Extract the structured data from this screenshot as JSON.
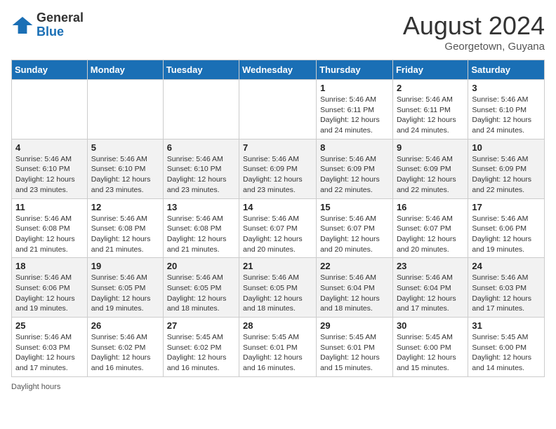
{
  "header": {
    "logo_general": "General",
    "logo_blue": "Blue",
    "month_year": "August 2024",
    "location": "Georgetown, Guyana"
  },
  "footer": {
    "daylight_label": "Daylight hours"
  },
  "days_of_week": [
    "Sunday",
    "Monday",
    "Tuesday",
    "Wednesday",
    "Thursday",
    "Friday",
    "Saturday"
  ],
  "weeks": [
    [
      {
        "day": "",
        "info": ""
      },
      {
        "day": "",
        "info": ""
      },
      {
        "day": "",
        "info": ""
      },
      {
        "day": "",
        "info": ""
      },
      {
        "day": "1",
        "info": "Sunrise: 5:46 AM\nSunset: 6:11 PM\nDaylight: 12 hours\nand 24 minutes."
      },
      {
        "day": "2",
        "info": "Sunrise: 5:46 AM\nSunset: 6:11 PM\nDaylight: 12 hours\nand 24 minutes."
      },
      {
        "day": "3",
        "info": "Sunrise: 5:46 AM\nSunset: 6:10 PM\nDaylight: 12 hours\nand 24 minutes."
      }
    ],
    [
      {
        "day": "4",
        "info": "Sunrise: 5:46 AM\nSunset: 6:10 PM\nDaylight: 12 hours\nand 23 minutes."
      },
      {
        "day": "5",
        "info": "Sunrise: 5:46 AM\nSunset: 6:10 PM\nDaylight: 12 hours\nand 23 minutes."
      },
      {
        "day": "6",
        "info": "Sunrise: 5:46 AM\nSunset: 6:10 PM\nDaylight: 12 hours\nand 23 minutes."
      },
      {
        "day": "7",
        "info": "Sunrise: 5:46 AM\nSunset: 6:09 PM\nDaylight: 12 hours\nand 23 minutes."
      },
      {
        "day": "8",
        "info": "Sunrise: 5:46 AM\nSunset: 6:09 PM\nDaylight: 12 hours\nand 22 minutes."
      },
      {
        "day": "9",
        "info": "Sunrise: 5:46 AM\nSunset: 6:09 PM\nDaylight: 12 hours\nand 22 minutes."
      },
      {
        "day": "10",
        "info": "Sunrise: 5:46 AM\nSunset: 6:09 PM\nDaylight: 12 hours\nand 22 minutes."
      }
    ],
    [
      {
        "day": "11",
        "info": "Sunrise: 5:46 AM\nSunset: 6:08 PM\nDaylight: 12 hours\nand 21 minutes."
      },
      {
        "day": "12",
        "info": "Sunrise: 5:46 AM\nSunset: 6:08 PM\nDaylight: 12 hours\nand 21 minutes."
      },
      {
        "day": "13",
        "info": "Sunrise: 5:46 AM\nSunset: 6:08 PM\nDaylight: 12 hours\nand 21 minutes."
      },
      {
        "day": "14",
        "info": "Sunrise: 5:46 AM\nSunset: 6:07 PM\nDaylight: 12 hours\nand 20 minutes."
      },
      {
        "day": "15",
        "info": "Sunrise: 5:46 AM\nSunset: 6:07 PM\nDaylight: 12 hours\nand 20 minutes."
      },
      {
        "day": "16",
        "info": "Sunrise: 5:46 AM\nSunset: 6:07 PM\nDaylight: 12 hours\nand 20 minutes."
      },
      {
        "day": "17",
        "info": "Sunrise: 5:46 AM\nSunset: 6:06 PM\nDaylight: 12 hours\nand 19 minutes."
      }
    ],
    [
      {
        "day": "18",
        "info": "Sunrise: 5:46 AM\nSunset: 6:06 PM\nDaylight: 12 hours\nand 19 minutes."
      },
      {
        "day": "19",
        "info": "Sunrise: 5:46 AM\nSunset: 6:05 PM\nDaylight: 12 hours\nand 19 minutes."
      },
      {
        "day": "20",
        "info": "Sunrise: 5:46 AM\nSunset: 6:05 PM\nDaylight: 12 hours\nand 18 minutes."
      },
      {
        "day": "21",
        "info": "Sunrise: 5:46 AM\nSunset: 6:05 PM\nDaylight: 12 hours\nand 18 minutes."
      },
      {
        "day": "22",
        "info": "Sunrise: 5:46 AM\nSunset: 6:04 PM\nDaylight: 12 hours\nand 18 minutes."
      },
      {
        "day": "23",
        "info": "Sunrise: 5:46 AM\nSunset: 6:04 PM\nDaylight: 12 hours\nand 17 minutes."
      },
      {
        "day": "24",
        "info": "Sunrise: 5:46 AM\nSunset: 6:03 PM\nDaylight: 12 hours\nand 17 minutes."
      }
    ],
    [
      {
        "day": "25",
        "info": "Sunrise: 5:46 AM\nSunset: 6:03 PM\nDaylight: 12 hours\nand 17 minutes."
      },
      {
        "day": "26",
        "info": "Sunrise: 5:46 AM\nSunset: 6:02 PM\nDaylight: 12 hours\nand 16 minutes."
      },
      {
        "day": "27",
        "info": "Sunrise: 5:45 AM\nSunset: 6:02 PM\nDaylight: 12 hours\nand 16 minutes."
      },
      {
        "day": "28",
        "info": "Sunrise: 5:45 AM\nSunset: 6:01 PM\nDaylight: 12 hours\nand 16 minutes."
      },
      {
        "day": "29",
        "info": "Sunrise: 5:45 AM\nSunset: 6:01 PM\nDaylight: 12 hours\nand 15 minutes."
      },
      {
        "day": "30",
        "info": "Sunrise: 5:45 AM\nSunset: 6:00 PM\nDaylight: 12 hours\nand 15 minutes."
      },
      {
        "day": "31",
        "info": "Sunrise: 5:45 AM\nSunset: 6:00 PM\nDaylight: 12 hours\nand 14 minutes."
      }
    ]
  ]
}
